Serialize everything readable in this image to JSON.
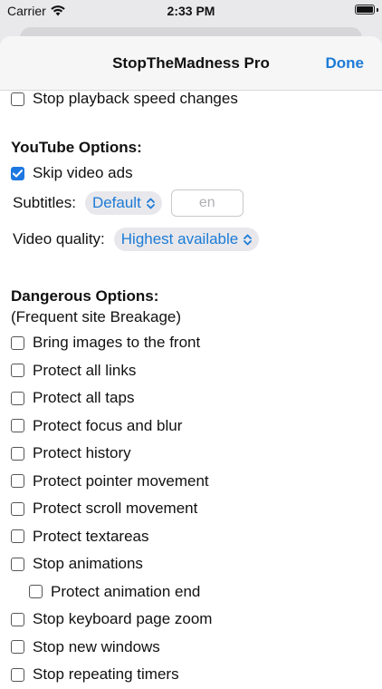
{
  "status": {
    "carrier": "Carrier",
    "time": "2:33 PM"
  },
  "nav": {
    "title": "StopTheMadness Pro",
    "done": "Done"
  },
  "general": {
    "stop_playback": "Stop playback speed changes"
  },
  "youtube": {
    "header": "YouTube Options:",
    "skip_ads": "Skip video ads",
    "subtitles_label": "Subtitles:",
    "subtitles_value": "Default",
    "subtitles_lang_placeholder": "en",
    "quality_label": "Video quality:",
    "quality_value": "Highest available"
  },
  "dangerous": {
    "header": "Dangerous Options:",
    "note": "(Frequent site Breakage)",
    "items": [
      "Bring images to the front",
      "Protect all links",
      "Protect all taps",
      "Protect focus and blur",
      "Protect history",
      "Protect pointer movement",
      "Protect scroll movement",
      "Protect textareas",
      "Stop animations",
      "Protect animation end",
      "Stop keyboard page zoom",
      "Stop new windows",
      "Stop repeating timers"
    ]
  },
  "colors": {
    "accent": "#1d7bd6",
    "checkbox": "#1d78e0"
  }
}
